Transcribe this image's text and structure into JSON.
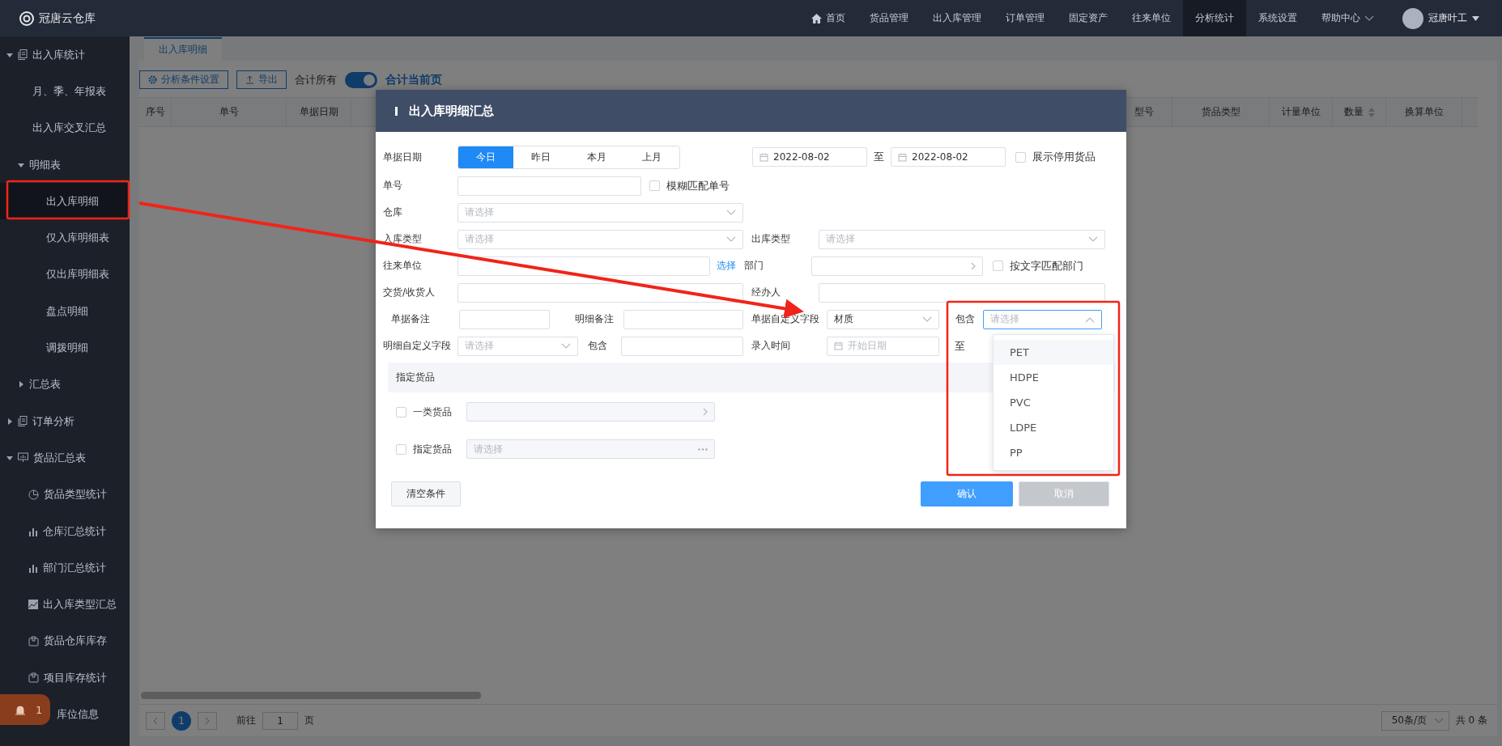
{
  "app": {
    "logo": "冠唐云仓库"
  },
  "nav": [
    {
      "label": "首页",
      "selected": false,
      "kind": "home"
    },
    {
      "label": "货品管理",
      "selected": false
    },
    {
      "label": "出入库管理",
      "selected": false
    },
    {
      "label": "订单管理",
      "selected": false
    },
    {
      "label": "固定资产",
      "selected": false
    },
    {
      "label": "往来单位",
      "selected": false
    },
    {
      "label": "分析统计",
      "selected": true
    },
    {
      "label": "系统设置",
      "selected": false
    },
    {
      "label": "帮助中心",
      "selected": false,
      "dropdown": true
    }
  ],
  "user": {
    "name": "冠唐叶工"
  },
  "sidebar": {
    "items": [
      {
        "label": "出入库统计",
        "kind": "doc",
        "expanded": true,
        "selected": false,
        "children": [
          {
            "label": "月、季、年报表",
            "selected": false
          },
          {
            "label": "出入库交叉汇总",
            "selected": false
          },
          {
            "label": "明细表",
            "expanded": true,
            "selected": false,
            "children": [
              {
                "label": "出入库明细",
                "selected": true
              },
              {
                "label": "仅入库明细表",
                "selected": false
              },
              {
                "label": "仅出库明细表",
                "selected": false
              },
              {
                "label": "盘点明细",
                "selected": false
              },
              {
                "label": "调拨明细",
                "selected": false
              }
            ]
          },
          {
            "label": "汇总表",
            "expanded": false,
            "selected": false
          }
        ]
      },
      {
        "label": "订单分析",
        "kind": "doc",
        "expanded": false,
        "selected": false
      },
      {
        "label": "货品汇总表",
        "kind": "board",
        "expanded": true,
        "selected": false,
        "children": [
          {
            "label": "货品类型统计",
            "kind": "pie",
            "selected": false
          },
          {
            "label": "仓库汇总统计",
            "kind": "bar",
            "selected": false
          },
          {
            "label": "部门汇总统计",
            "kind": "bar",
            "selected": false
          },
          {
            "label": "出入库类型汇总",
            "kind": "area",
            "selected": false
          },
          {
            "label": "货品仓库库存",
            "kind": "box",
            "selected": false
          },
          {
            "label": "项目库存统计",
            "kind": "box",
            "selected": false
          },
          {
            "label": "库位信息",
            "kind": "covered",
            "selected": false
          }
        ]
      }
    ]
  },
  "alert_badge": {
    "count": "1"
  },
  "tabs": [
    {
      "label": "出入库明细",
      "selected": true
    }
  ],
  "toolbar": {
    "buttons": [
      {
        "label": "分析条件设置",
        "kind": "gear"
      },
      {
        "label": "导出",
        "kind": "upload"
      }
    ],
    "total_all": "合计所有",
    "total_switch": {
      "on": true
    },
    "total_page": "合计当前页"
  },
  "table": {
    "columns": [
      {
        "label": "序号"
      },
      {
        "label": "单号"
      },
      {
        "label": "单据日期"
      },
      {
        "label": "型号"
      },
      {
        "label": "货品类型"
      },
      {
        "label": "计量单位"
      },
      {
        "label": "数量",
        "sortable": true
      },
      {
        "label": "换算单位"
      }
    ]
  },
  "pagination": {
    "pages": [
      {
        "label": "1",
        "selected": true
      }
    ],
    "goto_label": "前往",
    "goto_value": "1",
    "goto_suffix": "页",
    "page_size": "50条/页",
    "total": "共 0 条"
  },
  "dialog": {
    "title": "出入库明细汇总",
    "doc_date": {
      "label": "单据日期",
      "options": [
        {
          "label": "今日",
          "selected": true
        },
        {
          "label": "昨日",
          "selected": false
        },
        {
          "label": "本月",
          "selected": false
        },
        {
          "label": "上月",
          "selected": false
        }
      ],
      "from": "2022-08-02",
      "sep": "至",
      "to": "2022-08-02"
    },
    "show_disabled": {
      "label": "展示停用货品",
      "checked": false
    },
    "doc_no": {
      "label": "单号"
    },
    "fuzzy": {
      "label": "模糊匹配单号",
      "checked": false
    },
    "warehouse": {
      "label": "仓库",
      "placeholder": "请选择"
    },
    "in_type": {
      "label": "入库类型",
      "placeholder": "请选择"
    },
    "out_type": {
      "label": "出库类型",
      "placeholder": "请选择"
    },
    "partner": {
      "label": "往来单位",
      "link": "选择"
    },
    "department": {
      "label": "部门"
    },
    "dept_text_match": {
      "label": "按文字匹配部门",
      "checked": false
    },
    "consignee": {
      "label": "交货/收货人"
    },
    "handler": {
      "label": "经办人"
    },
    "doc_note": {
      "label": "单据备注"
    },
    "detail_note": {
      "label": "明细备注"
    },
    "doc_custom": {
      "label": "单据自定义字段",
      "value": "材质",
      "contains_label": "包含",
      "contains": {
        "placeholder": "请选择",
        "expanded": true,
        "options": [
          {
            "label": "PET",
            "hovered": true
          },
          {
            "label": "HDPE",
            "hovered": false
          },
          {
            "label": "PVC",
            "hovered": false
          },
          {
            "label": "LDPE",
            "hovered": false
          },
          {
            "label": "PP",
            "hovered": false
          }
        ]
      }
    },
    "detail_custom": {
      "label": "明细自定义字段",
      "placeholder": "请选择",
      "contains_label": "包含"
    },
    "entry_time": {
      "label": "录入时间",
      "placeholder": "开始日期",
      "sep": "至"
    },
    "goods_section": {
      "title": "指定货品"
    },
    "category_goods": {
      "label": "一类货品",
      "checked": false
    },
    "specific_goods": {
      "label": "指定货品",
      "checked": false,
      "placeholder": "请选择"
    },
    "clear": {
      "label": "清空条件"
    },
    "confirm": {
      "label": "确认"
    },
    "cancel": {
      "label": "取消",
      "disabled": true
    }
  }
}
